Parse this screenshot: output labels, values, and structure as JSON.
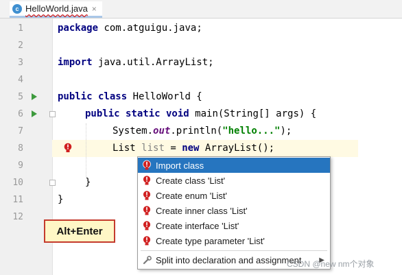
{
  "tab": {
    "title": "HelloWorld.java",
    "close": "×",
    "icon": "class-c-icon",
    "icon_letter": "c"
  },
  "editor": {
    "lines": [
      {
        "n": "1",
        "tokens": [
          [
            "kw",
            "package"
          ],
          [
            "",
            "com.atguigu.java;"
          ]
        ]
      },
      {
        "n": "2",
        "tokens": []
      },
      {
        "n": "3",
        "tokens": [
          [
            "kw",
            "import"
          ],
          [
            "",
            "java.util.ArrayList;"
          ]
        ]
      },
      {
        "n": "4",
        "tokens": []
      },
      {
        "n": "5",
        "tokens": [
          [
            "kw",
            "public class"
          ],
          [
            "",
            "HelloWorld {"
          ]
        ]
      },
      {
        "n": "6",
        "tokens": [
          [
            "kw",
            "public static void"
          ],
          [
            "",
            "main(String[] args) {"
          ]
        ]
      },
      {
        "n": "7",
        "tokens": [
          [
            "",
            "System."
          ],
          [
            "fld",
            "out"
          ],
          [
            "",
            ".println("
          ],
          [
            "str",
            "\"hello...\""
          ],
          [
            "",
            ");"
          ]
        ]
      },
      {
        "n": "8",
        "tokens": [
          [
            "",
            "List"
          ],
          [
            "gray",
            "list"
          ],
          [
            "",
            "="
          ],
          [
            "kw",
            "new"
          ],
          [
            "",
            "ArrayList();"
          ]
        ]
      },
      {
        "n": "9",
        "tokens": []
      },
      {
        "n": "10",
        "tokens": [
          [
            "",
            "}"
          ]
        ]
      },
      {
        "n": "11",
        "tokens": [
          [
            "",
            "}"
          ]
        ]
      },
      {
        "n": "12",
        "tokens": []
      }
    ],
    "highlighted_line": "8"
  },
  "popup": {
    "items": [
      {
        "label": "Import class",
        "selected": true,
        "icon": "error-bulb-icon"
      },
      {
        "label": "Create class 'List'",
        "selected": false,
        "icon": "error-bulb-icon"
      },
      {
        "label": "Create enum 'List'",
        "selected": false,
        "icon": "error-bulb-icon"
      },
      {
        "label": "Create inner class 'List'",
        "selected": false,
        "icon": "error-bulb-icon"
      },
      {
        "label": "Create interface 'List'",
        "selected": false,
        "icon": "error-bulb-icon"
      },
      {
        "label": "Create type parameter 'List'",
        "selected": false,
        "icon": "error-bulb-icon"
      }
    ],
    "secondary": {
      "label": "Split into declaration and assignment",
      "icon": "wrench-icon",
      "arrow": "▶"
    }
  },
  "shortcut_label": "Alt+Enter",
  "watermark": "CSDN @new nm个对象",
  "colors": {
    "selection": "#2675bf",
    "keyword": "#000080",
    "string": "#008000",
    "error": "#d02020",
    "line_highlight": "#fffae3"
  }
}
